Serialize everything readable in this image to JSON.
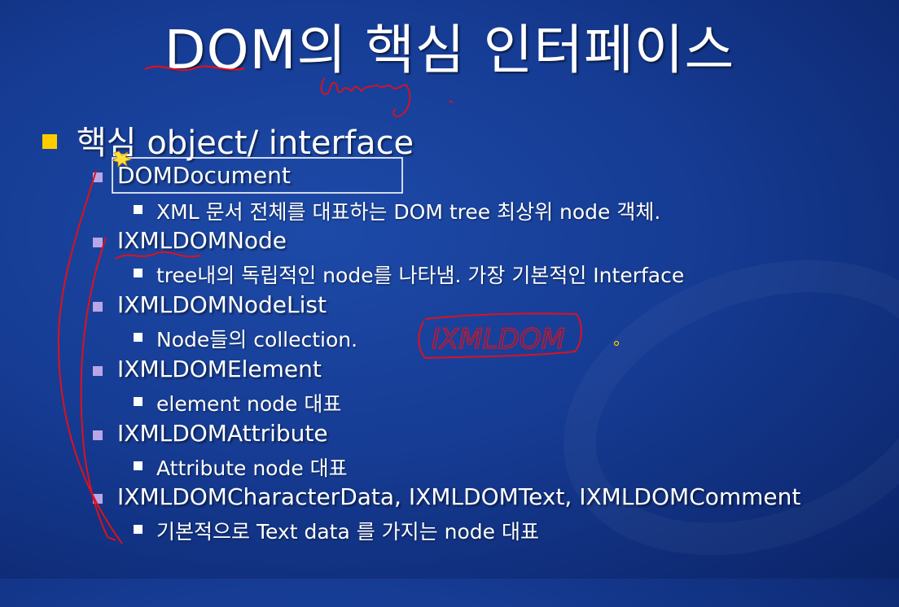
{
  "title": "DOM의 핵심 인터페이스",
  "main_point": "핵심 object/ interface",
  "items": [
    {
      "name": "DOMDocument",
      "desc": "XML 문서 전체를 대표하는 DOM tree 최상위 node 객체."
    },
    {
      "name": "IXMLDOMNode",
      "desc": "tree내의 독립적인 node를 나타냄. 가장 기본적인 Interface"
    },
    {
      "name": "IXMLDOMNodeList",
      "desc": "Node들의 collection."
    },
    {
      "name": "IXMLDOMElement",
      "desc": "element node 대표"
    },
    {
      "name": "IXMLDOMAttribute",
      "desc": "Attribute node 대표"
    },
    {
      "name": "IXMLDOMCharacterData, IXMLDOMText, IXMLDOMComment",
      "desc": "기본적으로 Text data 를 가지는 node 대표"
    }
  ],
  "annotations": {
    "handwritten_top": "library",
    "handwritten_box": "IXMLDOM"
  },
  "colors": {
    "background": "#163c94",
    "main_bullet": "#ffcc00",
    "sub_bullet": "#b9a6e6",
    "ink": "#e0101c"
  }
}
